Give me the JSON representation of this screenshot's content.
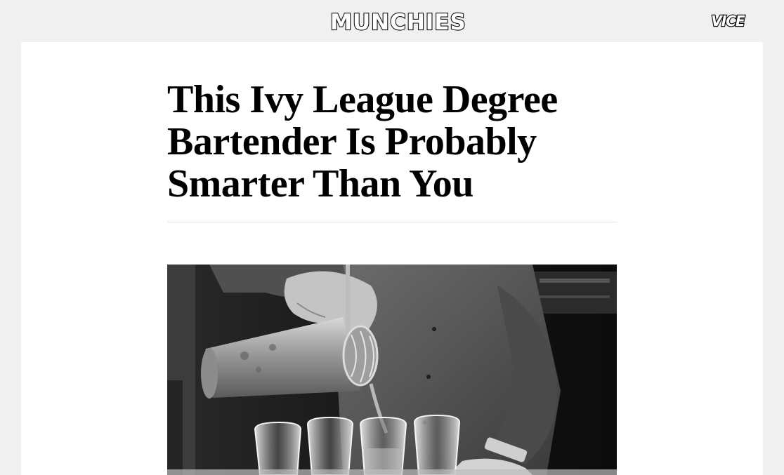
{
  "header": {
    "brand_logo_text": "MUNCHIES",
    "partner_logo_text": "VICE"
  },
  "article": {
    "headline": "This Ivy League Degree Bartender Is Probably Smarter Than You",
    "hero_image": {
      "subject": "bartender-straining-cocktail-photo",
      "style": "black-and-white"
    }
  }
}
